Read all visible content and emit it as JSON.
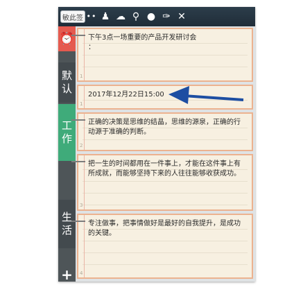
{
  "toolbar": {
    "tag_button_label": "敏此签",
    "more_icon": "••",
    "icons": [
      {
        "name": "user-icon",
        "glyph": "♟"
      },
      {
        "name": "cloud-icon",
        "glyph": "☁"
      },
      {
        "name": "search-icon",
        "glyph": "⚲"
      },
      {
        "name": "chat-icon",
        "glyph": "●"
      },
      {
        "name": "attach-icon",
        "glyph": "✑"
      },
      {
        "name": "close-icon",
        "glyph": "✕"
      }
    ]
  },
  "sidebar": {
    "alarm_icon": "⏰",
    "tabs": [
      {
        "name": "tab-default",
        "lines": [
          "默",
          "认"
        ]
      },
      {
        "name": "tab-work",
        "lines": [
          "工",
          "作"
        ]
      },
      {
        "name": "tab-life",
        "lines": [
          "生",
          "活"
        ]
      }
    ],
    "add_label": "+"
  },
  "notes": [
    {
      "text": "下午3点一场重要的产品开发研讨会\n：",
      "num": "1",
      "extra": ""
    },
    {
      "text": "2017年12月22日15:00",
      "num": "1",
      "extra": "•"
    },
    {
      "text": "正确的决策是思维的结晶，思维的源泉，正确的行动源于准确的判断。",
      "num": "2"
    },
    {
      "text": "把一生的时间都用在一件事上，才能在这件事上有所成就，而能够坚持下来的人往往能够收获成功。",
      "num": "3"
    },
    {
      "text": "专注做事，把事情做好是最好的自我提升，是成功的关键。",
      "num": "4"
    }
  ],
  "colors": {
    "accent_green": "#3fab7a",
    "alarm_red": "#e55a4f",
    "note_border": "#ecb28f",
    "arrow_blue": "#1d4ea2"
  }
}
